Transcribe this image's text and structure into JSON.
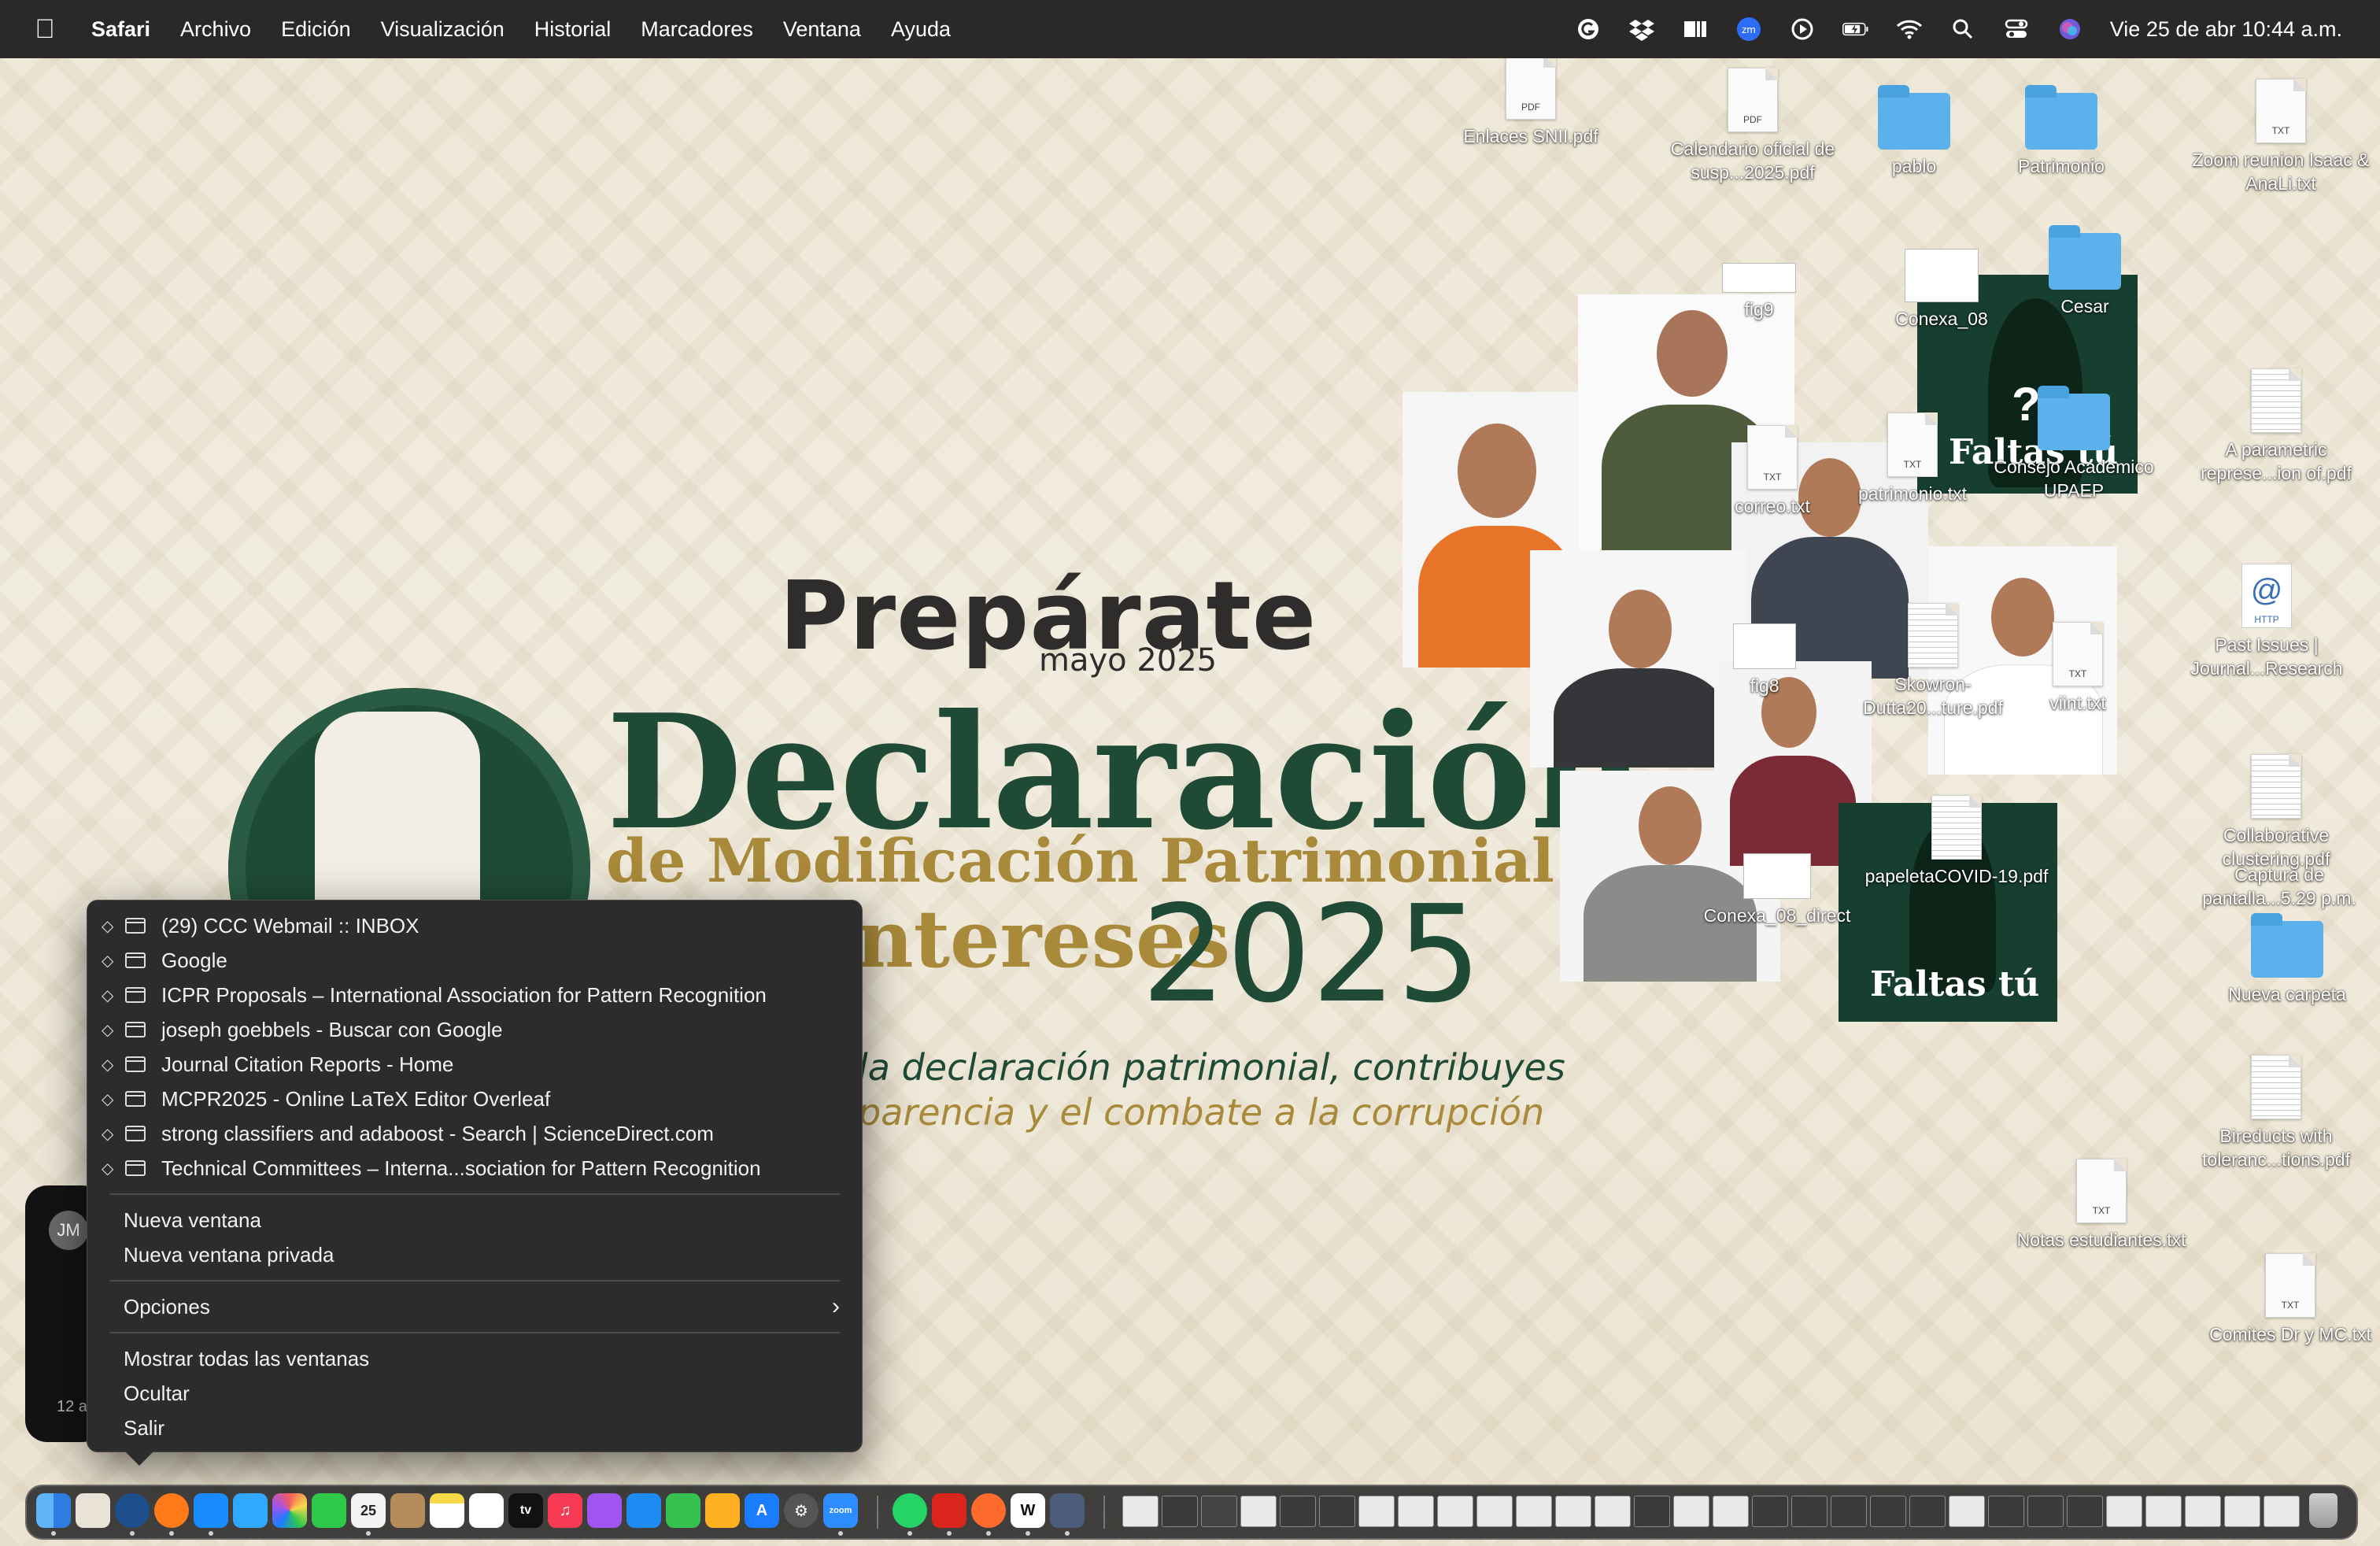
{
  "menubar": {
    "app": "Safari",
    "items": [
      "Archivo",
      "Edición",
      "Visualización",
      "Historial",
      "Marcadores",
      "Ventana",
      "Ayuda"
    ],
    "clock": "Vie 25 de abr  10:44 a.m."
  },
  "wallpaper": {
    "title": "Prepárate",
    "date": "mayo 2025",
    "heading": "Declaración",
    "subheading": "de Modificación Patrimonial",
    "subheading2": "y de Intereses",
    "year": "2025",
    "slogan_line1": "la declaración patrimonial, contribuyes",
    "slogan_line2": "parencia y el combate a la corrupción",
    "card1_text": "Faltas tú",
    "card2_text": "Faltas tú",
    "card_question": "?"
  },
  "desktop_icons": [
    {
      "label": "Enlaces SNII.pdf",
      "kind": "pdf",
      "tag": "PDF"
    },
    {
      "label": "Calendario oficial de susp...2025.pdf",
      "kind": "pdf",
      "tag": "PDF"
    },
    {
      "label": "pablo",
      "kind": "folder"
    },
    {
      "label": "Patrimonio",
      "kind": "folder"
    },
    {
      "label": "Zoom reunion Isaac & AnaLi.txt",
      "kind": "txt",
      "tag": "TXT"
    },
    {
      "label": "fig9",
      "kind": "image"
    },
    {
      "label": "Conexa_08",
      "kind": "image"
    },
    {
      "label": "Cesar",
      "kind": "folder"
    },
    {
      "label": "correo.txt",
      "kind": "txt",
      "tag": "TXT"
    },
    {
      "label": "patrimonio.txt",
      "kind": "txt",
      "tag": "TXT"
    },
    {
      "label": "Consejo Academico UPAEP",
      "kind": "folder"
    },
    {
      "label": "A parametric represe...ion of.pdf",
      "kind": "pdf-lines"
    },
    {
      "label": "Past Issues | Journal...Research",
      "kind": "http",
      "tag": "HTTP"
    },
    {
      "label": "fig8",
      "kind": "image"
    },
    {
      "label": "Skowron-Dutta20...ture.pdf",
      "kind": "pdf-lines"
    },
    {
      "label": "viint.txt",
      "kind": "txt",
      "tag": "TXT"
    },
    {
      "label": "Collaborative clustering.pdf",
      "kind": "pdf-lines"
    },
    {
      "label": "Captura de pantalla...5.29 p.m.",
      "kind": "image"
    },
    {
      "label": "papeletaCOVID-19.pdf",
      "kind": "pdf-lines"
    },
    {
      "label": "Conexa_08_direct",
      "kind": "image"
    },
    {
      "label": "Nueva carpeta",
      "kind": "folder"
    },
    {
      "label": "Bireducts with toleranc...tions.pdf",
      "kind": "pdf-lines"
    },
    {
      "label": "Notas estudiantes.txt",
      "kind": "txt",
      "tag": "TXT"
    },
    {
      "label": "Comites Dr y MC.txt",
      "kind": "txt",
      "tag": "TXT"
    }
  ],
  "widget": {
    "avatar": "JM",
    "time": "12 a"
  },
  "context_menu": {
    "windows": [
      "(29) CCC Webmail :: INBOX",
      "Google",
      "ICPR Proposals – International Association for Pattern Recognition",
      "joseph goebbels - Buscar con Google",
      "Journal Citation Reports - Home",
      "MCPR2025 - Online LaTeX Editor Overleaf",
      "strong classifiers and adaboost - Search | ScienceDirect.com",
      "Technical Committees – Interna...sociation for Pattern Recognition"
    ],
    "new_window": "Nueva ventana",
    "new_private_window": "Nueva ventana privada",
    "options": "Opciones",
    "show_all": "Mostrar todas las ventanas",
    "hide": "Ocultar",
    "quit": "Salir"
  },
  "dock": {
    "calendar_day": "25",
    "appletv_label": "tv",
    "zoom_label": "zoom",
    "colors": [
      "#2f7de1",
      "#e8e3d6",
      "#1d4f8c",
      "#ff7a18",
      "#1a8cff",
      "#31a8ff",
      "#f25d5d",
      "#2fc94a",
      "#f4f4f4",
      "#b48b5a",
      "#f8d94a",
      "#ffffff",
      "#111111",
      "#f93a55",
      "#a054f0",
      "#1d8bf1",
      "#36c24e",
      "#ffb020",
      "#1c7cff",
      "#555555",
      "#2d8cff",
      "#25d366",
      "#d9251c",
      "#ff6b2c",
      "#ffffff",
      "#4b5d7a"
    ]
  },
  "accent_colors": {
    "menu_bg": "#2c2c2e",
    "poster_green": "#1e4a36",
    "poster_gold": "#a98a3a"
  }
}
